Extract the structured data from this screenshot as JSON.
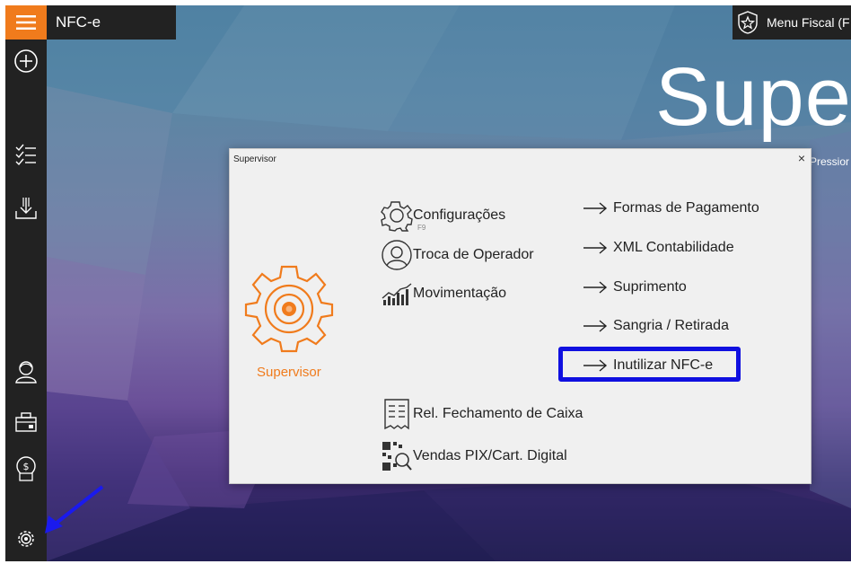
{
  "app": {
    "title": "NFC-e",
    "menu_fiscal": "Menu Fiscal (F",
    "hero_text": "Super",
    "hint_text": "Pressior"
  },
  "sidebar": {
    "items": [
      {
        "name": "menu-icon"
      },
      {
        "name": "add-icon"
      },
      {
        "name": "checklist-icon"
      },
      {
        "name": "download-icon"
      },
      {
        "name": "operator-icon"
      },
      {
        "name": "cash-register-icon"
      },
      {
        "name": "money-icon"
      },
      {
        "name": "gear-icon"
      }
    ]
  },
  "dialog": {
    "title": "Supervisor",
    "close": "×",
    "supervisor_label": "Supervisor",
    "f9_hint": "F9",
    "left_items": [
      {
        "label": "Configurações",
        "icon": "gear-icon"
      },
      {
        "label": "Troca de Operador",
        "icon": "user-icon"
      },
      {
        "label": "Movimentação",
        "icon": "chart-icon"
      },
      {
        "label": "Rel. Fechamento de Caixa",
        "icon": "receipt-icon"
      },
      {
        "label": "Vendas PIX/Cart. Digital",
        "icon": "qr-search-icon"
      }
    ],
    "right_items": [
      {
        "label": "Formas de Pagamento"
      },
      {
        "label": "XML Contabilidade"
      },
      {
        "label": "Suprimento"
      },
      {
        "label": "Sangria / Retirada"
      },
      {
        "label": "Inutilizar NFC-e",
        "highlighted": true
      }
    ]
  },
  "colors": {
    "accent": "#f07b1c",
    "sidebar": "#222222",
    "highlight": "#1010e0",
    "annotation_arrow": "#1a1aee"
  }
}
